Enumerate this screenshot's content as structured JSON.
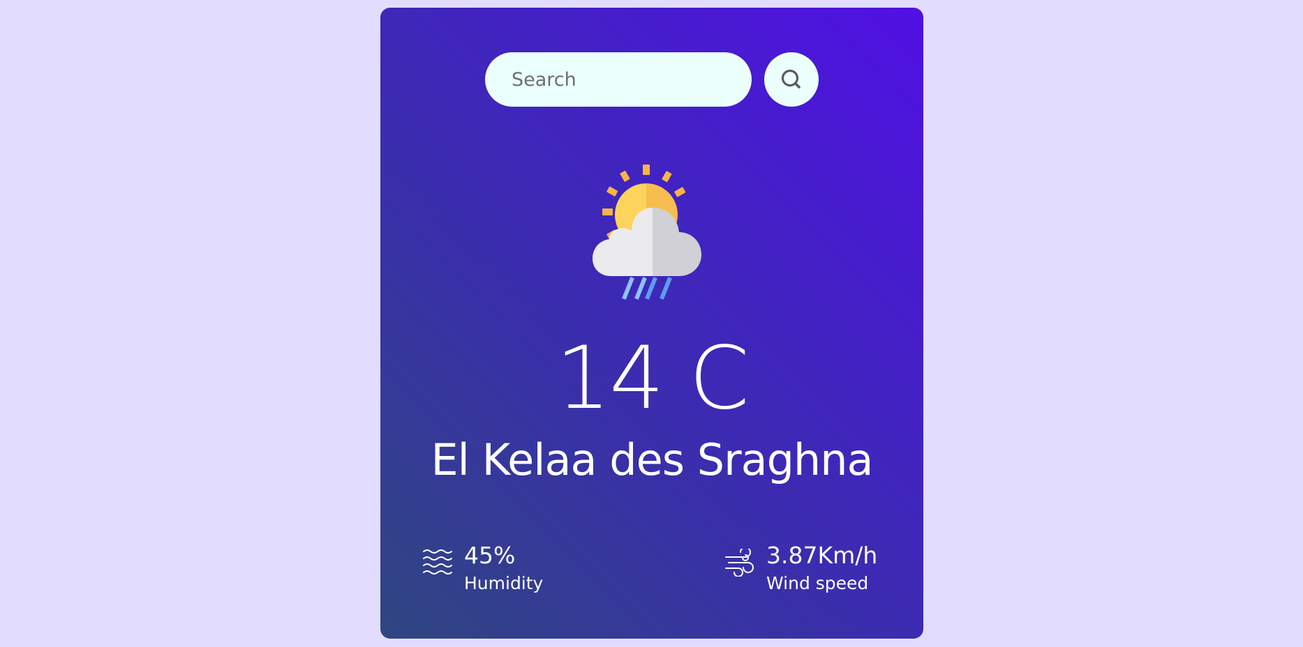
{
  "search": {
    "placeholder": "Search",
    "button_icon": "search-icon"
  },
  "weather": {
    "icon": "sun-cloud-rain-icon",
    "temperature": "14 C",
    "city": "El Kelaa des Sraghna"
  },
  "stats": {
    "humidity": {
      "icon": "humidity-waves-icon",
      "value": "45%",
      "label": "Humidity"
    },
    "wind": {
      "icon": "wind-icon",
      "value": "3.87Km/h",
      "label": "Wind speed"
    }
  },
  "colors": {
    "page_background": "#e2ddff",
    "card_gradient_start": "#2f4680",
    "card_gradient_end": "#5010e4",
    "search_background": "#ebfffc",
    "text": "#ffffff"
  }
}
